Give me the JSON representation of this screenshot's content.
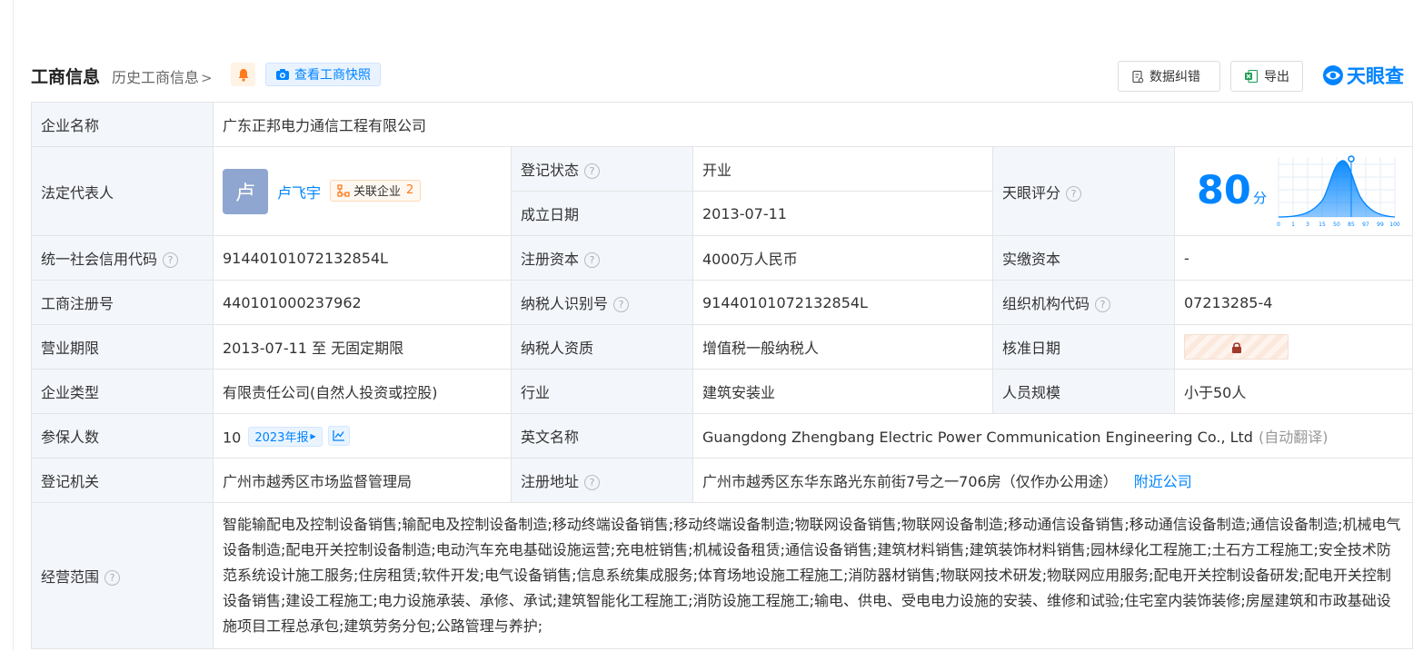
{
  "header": {
    "title": "工商信息",
    "history_link": "历史工商信息",
    "snapshot_button": "查看工商快照",
    "correct_button": "数据纠错",
    "export_button": "导出",
    "brand": "天眼查",
    "colors": {
      "accent": "#0084ff",
      "bell": "#ff7a1c"
    }
  },
  "labels": {
    "company_name": "企业名称",
    "legal_rep": "法定代表人",
    "reg_status": "登记状态",
    "est_date": "成立日期",
    "tianyan_score": "天眼评分",
    "credit_code": "统一社会信用代码",
    "reg_capital": "注册资本",
    "paid_capital": "实缴资本",
    "reg_number": "工商注册号",
    "taxpayer_id": "纳税人识别号",
    "org_code": "组织机构代码",
    "business_term": "营业期限",
    "taxpayer_qual": "纳税人资质",
    "approval_date": "核准日期",
    "company_type": "企业类型",
    "industry": "行业",
    "staff_size": "人员规模",
    "insured": "参保人数",
    "english_name": "英文名称",
    "reg_authority": "登记机关",
    "reg_address": "注册地址",
    "business_scope": "经营范围"
  },
  "values": {
    "company_name": "广东正邦电力通信工程有限公司",
    "legal_rep_avatar": "卢",
    "legal_rep_name": "卢飞宇",
    "related_label": "关联企业",
    "related_count": "2",
    "reg_status": "开业",
    "est_date": "2013-07-11",
    "score_value": "80",
    "score_unit": "分",
    "score_axis": [
      "0",
      "1",
      "3",
      "15",
      "50",
      "85",
      "97",
      "99",
      "100"
    ],
    "credit_code": "91440101072132854L",
    "reg_capital": "4000万人民币",
    "paid_capital": "-",
    "reg_number": "440101000237962",
    "taxpayer_id": "91440101072132854L",
    "org_code": "07213285-4",
    "business_term": "2013-07-11 至 无固定期限",
    "taxpayer_qual": "增值税一般纳税人",
    "company_type": "有限责任公司(自然人投资或控股)",
    "industry": "建筑安装业",
    "staff_size": "小于50人",
    "insured": "10",
    "insured_year": "2023年报",
    "english_name": "Guangdong Zhengbang Electric Power Communication Engineering Co., Ltd",
    "english_note": "(自动翻译)",
    "reg_authority": "广州市越秀区市场监督管理局",
    "reg_address": "广州市越秀区东华东路光东前街7号之一706房（仅作办公用途）",
    "nearby_link": "附近公司",
    "business_scope": "智能输配电及控制设备销售;输配电及控制设备制造;移动终端设备销售;移动终端设备制造;物联网设备销售;物联网设备制造;移动通信设备销售;移动通信设备制造;通信设备制造;机械电气设备制造;配电开关控制设备制造;电动汽车充电基础设施运营;充电桩销售;机械设备租赁;通信设备销售;建筑材料销售;建筑装饰材料销售;园林绿化工程施工;土石方工程施工;安全技术防范系统设计施工服务;住房租赁;软件开发;电气设备销售;信息系统集成服务;体育场地设施工程施工;消防器材销售;物联网技术研发;物联网应用服务;配电开关控制设备研发;配电开关控制设备销售;建设工程施工;电力设施承装、承修、承试;建筑智能化工程施工;消防设施工程施工;输电、供电、受电电力设施的安装、维修和试验;住宅室内装饰装修;房屋建筑和市政基础设施项目工程总承包;建筑劳务分包;公路管理与养护;"
  }
}
